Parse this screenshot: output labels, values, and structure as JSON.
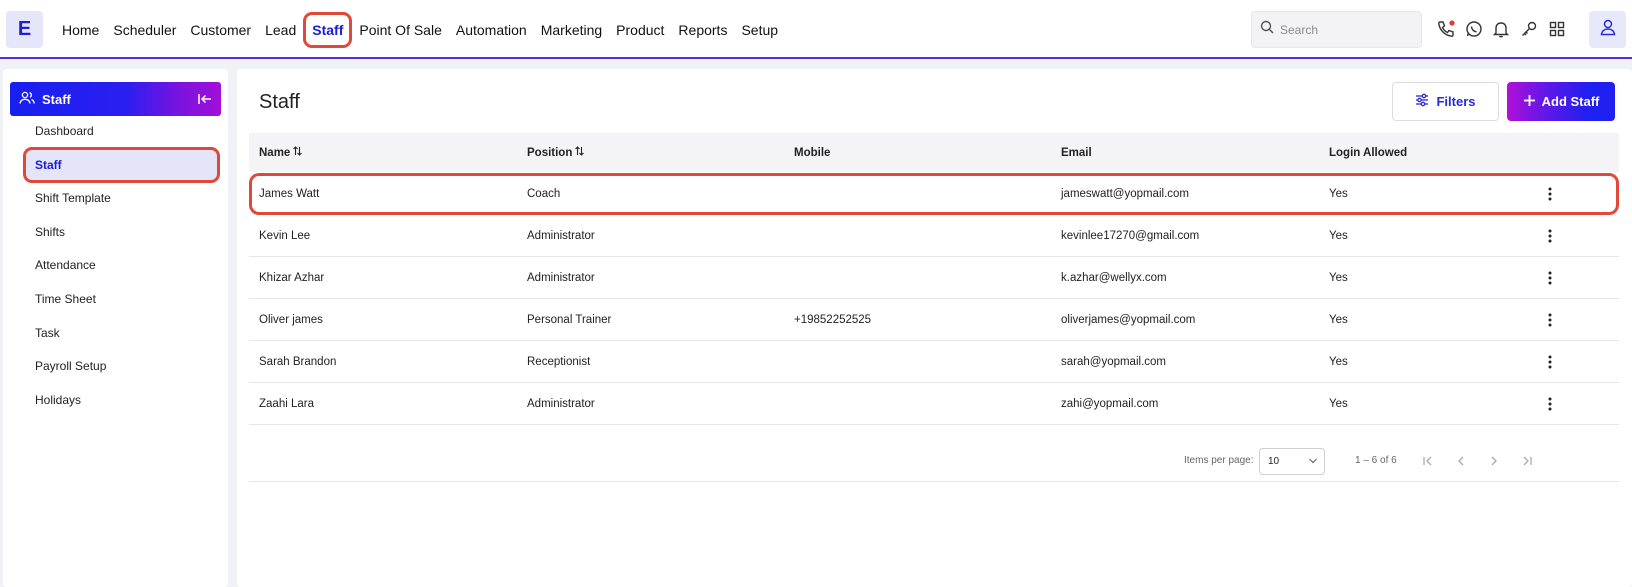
{
  "app": {
    "logo_letter": "E"
  },
  "nav": {
    "items": [
      "Home",
      "Scheduler",
      "Customer",
      "Lead",
      "Staff",
      "Point Of Sale",
      "Automation",
      "Marketing",
      "Product",
      "Reports",
      "Setup"
    ],
    "active": "Staff"
  },
  "search": {
    "placeholder": "Search"
  },
  "toolbar_icons": [
    "phone-icon",
    "whatsapp-icon",
    "bell-icon",
    "key-icon",
    "apps-grid-icon",
    "user-icon"
  ],
  "sidebar": {
    "header": "Staff",
    "items": [
      "Dashboard",
      "Staff",
      "Shift Template",
      "Shifts",
      "Attendance",
      "Time Sheet",
      "Task",
      "Payroll Setup",
      "Holidays"
    ],
    "active": "Staff"
  },
  "main": {
    "title": "Staff",
    "filters_label": "Filters",
    "add_label": "Add Staff"
  },
  "table": {
    "columns": [
      "Name",
      "Position",
      "Mobile",
      "Email",
      "Login Allowed"
    ],
    "rows": [
      {
        "name": "James Watt",
        "position": "Coach",
        "mobile": "",
        "email": "jameswatt@yopmail.com",
        "login": "Yes"
      },
      {
        "name": "Kevin Lee",
        "position": "Administrator",
        "mobile": "",
        "email": "kevinlee17270@gmail.com",
        "login": "Yes"
      },
      {
        "name": "Khizar Azhar",
        "position": "Administrator",
        "mobile": "",
        "email": "k.azhar@wellyx.com",
        "login": "Yes"
      },
      {
        "name": "Oliver james",
        "position": "Personal Trainer",
        "mobile": "+19852252525",
        "email": "oliverjames@yopmail.com",
        "login": "Yes"
      },
      {
        "name": "Sarah Brandon",
        "position": "Receptionist",
        "mobile": "",
        "email": "sarah@yopmail.com",
        "login": "Yes"
      },
      {
        "name": "Zaahi Lara",
        "position": "Administrator",
        "mobile": "",
        "email": "zahi@yopmail.com",
        "login": "Yes"
      }
    ]
  },
  "pagination": {
    "items_per_page_label": "Items per page:",
    "items_per_page": "10",
    "range": "1 – 6 of 6"
  },
  "colors": {
    "accent": "#1a1bd6",
    "highlight_outline": "#e0483a",
    "notification_dot": "#e53935"
  }
}
